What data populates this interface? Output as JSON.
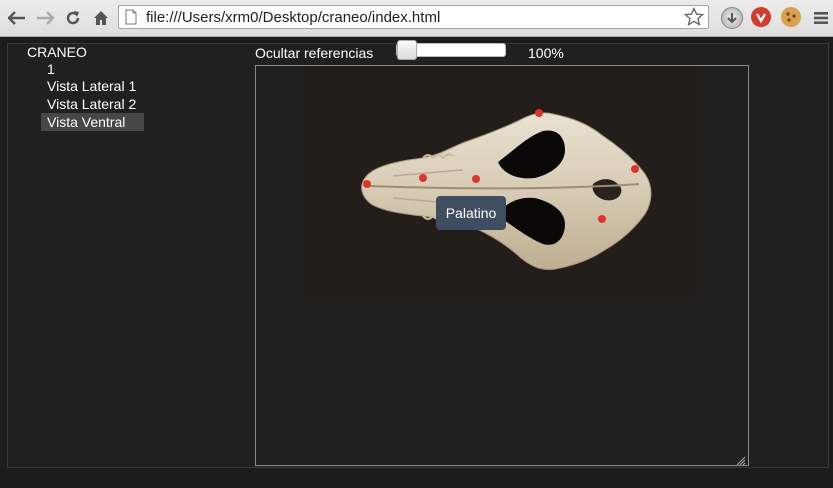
{
  "browser": {
    "url": "file:///Users/xrm0/Desktop/craneo/index.html",
    "back_icon": "arrow-left",
    "forward_icon": "arrow-right",
    "reload_icon": "reload",
    "home_icon": "home",
    "page_icon": "document",
    "star_icon": "star",
    "extensions": [
      "download-extension",
      "adblock-extension",
      "cookie-extension"
    ],
    "menu_icon": "hamburger-menu"
  },
  "tree": {
    "root": "CRANEO",
    "items": [
      {
        "label": "1"
      },
      {
        "label": "Vista Lateral 1"
      },
      {
        "label": "Vista Lateral 2"
      },
      {
        "label": "Vista Ventral",
        "selected": true
      }
    ]
  },
  "toolbar": {
    "hide_label": "Ocultar referencias",
    "slider_value": 0,
    "zoom": "100%"
  },
  "viewer": {
    "image_description_icon": "skull-ventral-photo",
    "marker_color": "#e0312a",
    "markers_count": 7,
    "tooltip": "Palatino"
  },
  "colors": {
    "background": "#1c1c1c",
    "selection": "#474747",
    "tooltip_bg": "#3f4d61"
  }
}
